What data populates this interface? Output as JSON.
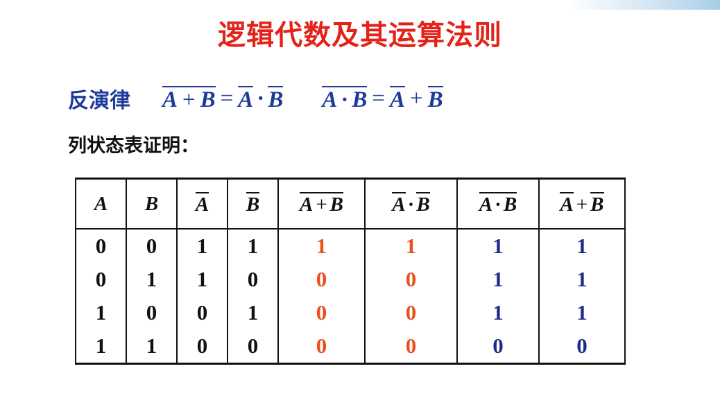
{
  "slide": {
    "title": "逻辑代数及其运算法则",
    "law_label": "反演律",
    "proof_label": "列状态表证明："
  },
  "symbols": {
    "a": "A",
    "b": "B",
    "plus": "+",
    "dot": "·",
    "equals": "="
  },
  "truth_table": {
    "columns": [
      "A",
      "B",
      "A̅",
      "B̅",
      "A+B (overbar)",
      "A̅·B̅",
      "A·B (overbar)",
      "A̅+B̅"
    ],
    "rows": [
      [
        "0",
        "0",
        "1",
        "1",
        "1",
        "1",
        "1",
        "1"
      ],
      [
        "0",
        "1",
        "1",
        "0",
        "0",
        "0",
        "1",
        "1"
      ],
      [
        "1",
        "0",
        "0",
        "1",
        "0",
        "0",
        "1",
        "1"
      ],
      [
        "1",
        "1",
        "0",
        "0",
        "0",
        "0",
        "0",
        "0"
      ]
    ]
  },
  "colors": {
    "title": "#e3231a",
    "formula": "#1e3a9a",
    "red_values": "#e8501c",
    "blue_values": "#1e2d8c"
  }
}
